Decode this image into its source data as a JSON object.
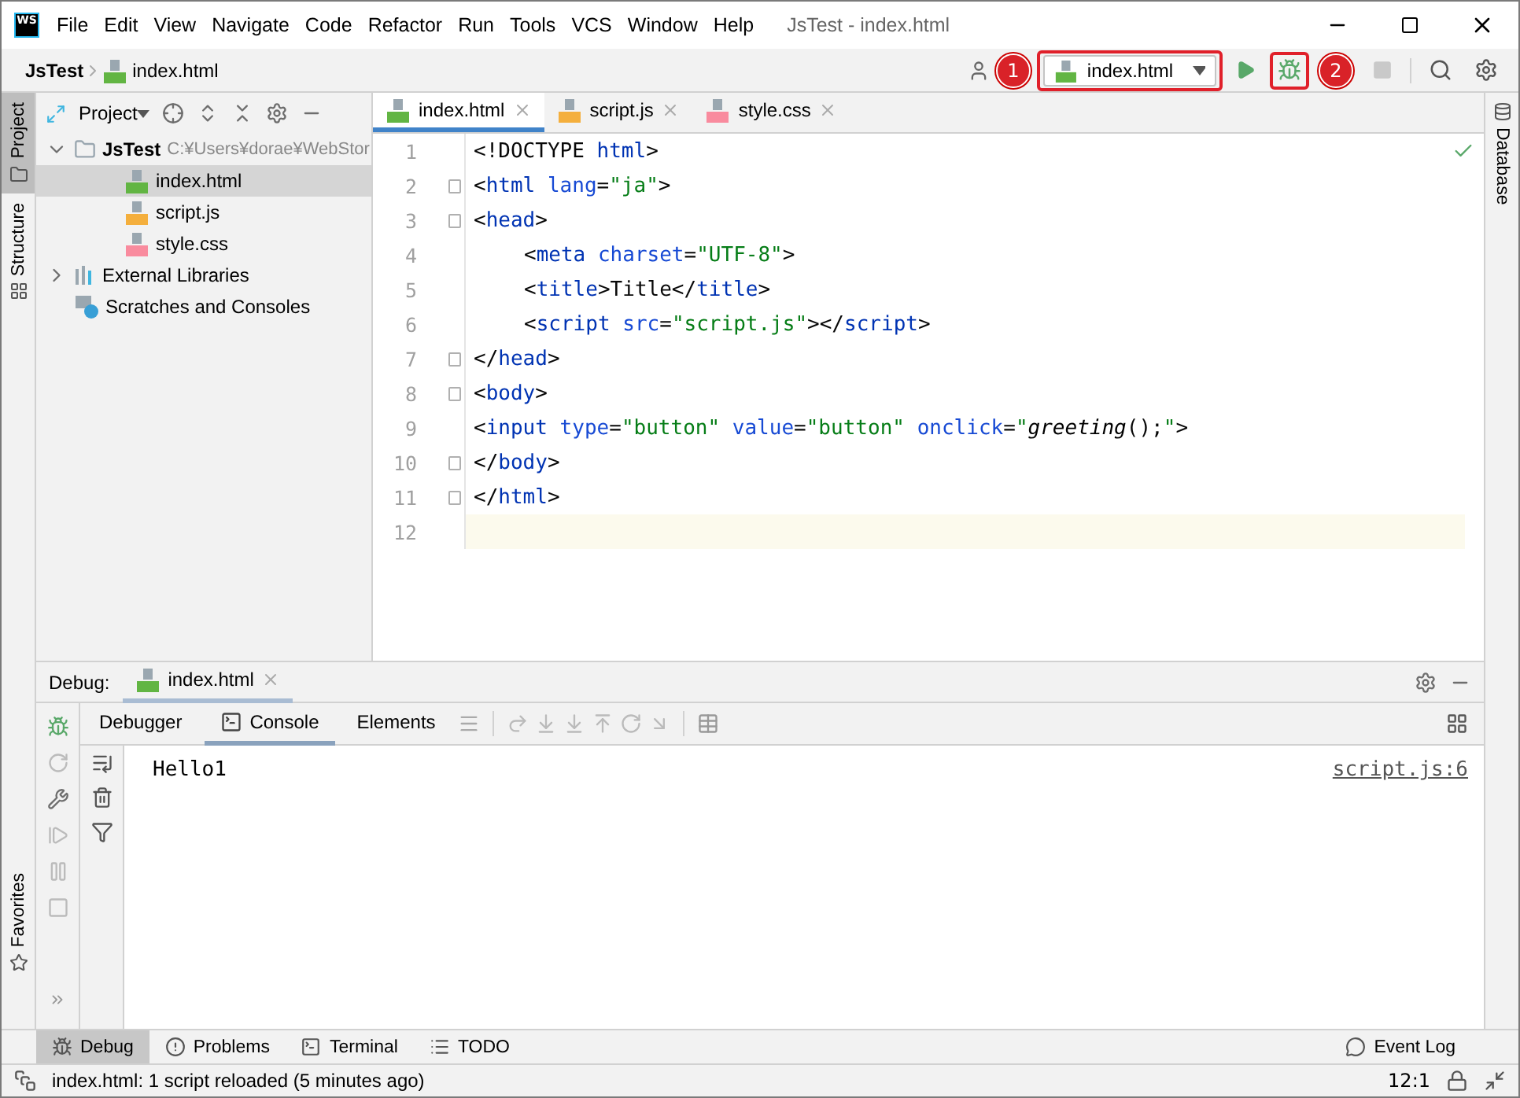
{
  "window": {
    "logo": "WS",
    "menu": [
      "File",
      "Edit",
      "View",
      "Navigate",
      "Code",
      "Refactor",
      "Run",
      "Tools",
      "VCS",
      "Window",
      "Help"
    ],
    "title": "JsTest - index.html"
  },
  "navbar": {
    "breadcrumb": [
      "JsTest",
      "index.html"
    ],
    "run_config": {
      "label": "index.html",
      "highlighted": true
    },
    "debug_button": {
      "highlighted": true
    },
    "annotations": [
      "1",
      "2"
    ]
  },
  "left_stripe": {
    "top": [
      {
        "label": "Project",
        "kind": "project",
        "selected": true
      },
      {
        "label": "Structure",
        "kind": "structure",
        "selected": false
      }
    ],
    "bottom": [
      {
        "label": "Favorites",
        "kind": "favorites",
        "selected": false
      }
    ]
  },
  "right_stripe": [
    {
      "label": "Database"
    }
  ],
  "project": {
    "title": "Project",
    "tree": [
      {
        "label": "JsTest",
        "path": "C:¥Users¥dorae¥WebStor",
        "kind": "folder",
        "expanded": true,
        "selected": false,
        "children": [
          {
            "label": "index.html",
            "kind": "html",
            "selected": true
          },
          {
            "label": "script.js",
            "kind": "js",
            "selected": false
          },
          {
            "label": "style.css",
            "kind": "css",
            "selected": false
          }
        ]
      },
      {
        "label": "External Libraries",
        "kind": "library",
        "expanded": false,
        "selected": false
      },
      {
        "label": "Scratches and Consoles",
        "kind": "scratch",
        "selected": false
      }
    ]
  },
  "editor": {
    "tabs": [
      {
        "label": "index.html",
        "kind": "html",
        "selected": true
      },
      {
        "label": "script.js",
        "kind": "js",
        "selected": false
      },
      {
        "label": "style.css",
        "kind": "css",
        "selected": false
      }
    ],
    "lines": [
      {
        "number": "1",
        "indented": false,
        "fold": false,
        "current": false,
        "tokens": [
          {
            "text": "<!DOCTYPE ",
            "kind": "plain"
          },
          {
            "text": "html",
            "kind": "tag"
          },
          {
            "text": ">",
            "kind": "plain"
          }
        ]
      },
      {
        "number": "2",
        "indented": false,
        "fold": true,
        "current": false,
        "tokens": [
          {
            "text": "<",
            "kind": "plain"
          },
          {
            "text": "html ",
            "kind": "tag"
          },
          {
            "text": "lang",
            "kind": "attr"
          },
          {
            "text": "=",
            "kind": "plain"
          },
          {
            "text": "\"ja\"",
            "kind": "string"
          },
          {
            "text": ">",
            "kind": "plain"
          }
        ]
      },
      {
        "number": "3",
        "indented": false,
        "fold": true,
        "current": false,
        "tokens": [
          {
            "text": "<",
            "kind": "plain"
          },
          {
            "text": "head",
            "kind": "tag"
          },
          {
            "text": ">",
            "kind": "plain"
          }
        ]
      },
      {
        "number": "4",
        "indented": true,
        "fold": false,
        "current": false,
        "tokens": [
          {
            "text": "<",
            "kind": "plain"
          },
          {
            "text": "meta ",
            "kind": "tag"
          },
          {
            "text": "charset",
            "kind": "attr"
          },
          {
            "text": "=",
            "kind": "plain"
          },
          {
            "text": "\"UTF-8\"",
            "kind": "string"
          },
          {
            "text": ">",
            "kind": "plain"
          }
        ]
      },
      {
        "number": "5",
        "indented": true,
        "fold": false,
        "current": false,
        "tokens": [
          {
            "text": "<",
            "kind": "plain"
          },
          {
            "text": "title",
            "kind": "tag"
          },
          {
            "text": ">Title</",
            "kind": "plain"
          },
          {
            "text": "title",
            "kind": "tag"
          },
          {
            "text": ">",
            "kind": "plain"
          }
        ]
      },
      {
        "number": "6",
        "indented": true,
        "fold": false,
        "current": false,
        "tokens": [
          {
            "text": "<",
            "kind": "plain"
          },
          {
            "text": "script ",
            "kind": "tag"
          },
          {
            "text": "src",
            "kind": "attr"
          },
          {
            "text": "=",
            "kind": "plain"
          },
          {
            "text": "\"script.js\"",
            "kind": "string"
          },
          {
            "text": "></",
            "kind": "plain"
          },
          {
            "text": "script",
            "kind": "tag"
          },
          {
            "text": ">",
            "kind": "plain"
          }
        ]
      },
      {
        "number": "7",
        "indented": false,
        "fold": true,
        "current": false,
        "tokens": [
          {
            "text": "</",
            "kind": "plain"
          },
          {
            "text": "head",
            "kind": "tag"
          },
          {
            "text": ">",
            "kind": "plain"
          }
        ]
      },
      {
        "number": "8",
        "indented": false,
        "fold": true,
        "current": false,
        "tokens": [
          {
            "text": "<",
            "kind": "plain"
          },
          {
            "text": "body",
            "kind": "tag"
          },
          {
            "text": ">",
            "kind": "plain"
          }
        ]
      },
      {
        "number": "9",
        "indented": false,
        "fold": false,
        "current": false,
        "tokens": [
          {
            "text": "<",
            "kind": "plain"
          },
          {
            "text": "input ",
            "kind": "tag"
          },
          {
            "text": "type",
            "kind": "attr"
          },
          {
            "text": "=",
            "kind": "plain"
          },
          {
            "text": "\"button\" ",
            "kind": "string"
          },
          {
            "text": "value",
            "kind": "attr"
          },
          {
            "text": "=",
            "kind": "plain"
          },
          {
            "text": "\"button\" ",
            "kind": "string"
          },
          {
            "text": "onclick",
            "kind": "attr"
          },
          {
            "text": "=",
            "kind": "plain"
          },
          {
            "text": "\"",
            "kind": "string"
          },
          {
            "text": "greeting",
            "kind": "call"
          },
          {
            "text": "();",
            "kind": "plain"
          },
          {
            "text": "\"",
            "kind": "string"
          },
          {
            "text": ">",
            "kind": "plain"
          }
        ]
      },
      {
        "number": "10",
        "indented": false,
        "fold": true,
        "current": false,
        "tokens": [
          {
            "text": "</",
            "kind": "plain"
          },
          {
            "text": "body",
            "kind": "tag"
          },
          {
            "text": ">",
            "kind": "plain"
          }
        ]
      },
      {
        "number": "11",
        "indented": false,
        "fold": true,
        "current": false,
        "tokens": [
          {
            "text": "</",
            "kind": "plain"
          },
          {
            "text": "html",
            "kind": "tag"
          },
          {
            "text": ">",
            "kind": "plain"
          }
        ]
      },
      {
        "number": "12",
        "indented": false,
        "fold": false,
        "current": true
      }
    ]
  },
  "debug": {
    "label": "Debug:",
    "session_tab": {
      "label": "index.html"
    },
    "tabs": [
      {
        "label": "Debugger",
        "selected": false
      },
      {
        "label": "Console",
        "selected": true
      },
      {
        "label": "Elements",
        "selected": false
      }
    ],
    "console": {
      "output": "Hello1",
      "source": "script.js:6"
    }
  },
  "tool_windows": [
    {
      "label": "Debug",
      "kind": "debug",
      "selected": true
    },
    {
      "label": "Problems",
      "kind": "problems",
      "selected": false
    },
    {
      "label": "Terminal",
      "kind": "terminal",
      "selected": false
    },
    {
      "label": "TODO",
      "kind": "todo",
      "selected": false
    }
  ],
  "event_log": {
    "label": "Event Log"
  },
  "status_bar": {
    "message": "index.html: 1 script reloaded (5 minutes ago)",
    "position": "12:1"
  }
}
